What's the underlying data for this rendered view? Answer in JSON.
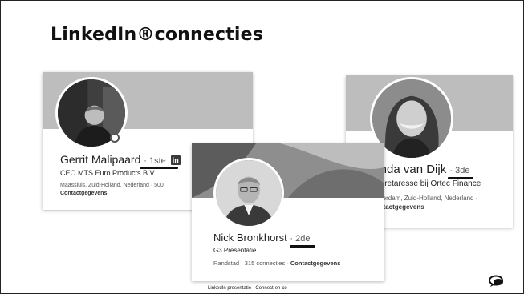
{
  "slide": {
    "title": "LinkedIn®connecties"
  },
  "cards": [
    {
      "name": "Gerrit Malipaard",
      "degree": "1ste",
      "headline": "CEO MTS Euro Products B.V.",
      "location": "Maassluis, Zuid-Holland, Nederland · 500",
      "contact": "Contactgegevens"
    },
    {
      "name": "Nick Bronkhorst",
      "degree": "2de",
      "headline": "G3 Presentatie",
      "location": "Randstad · 315 connecties · ",
      "contact": "Contactgegevens"
    },
    {
      "name": "Linda van Dijk",
      "degree": "3de",
      "headline": "Secretaresse bij Ortec Finance",
      "location": "Rotterdam, Zuid-Holland, Nederland ·",
      "contact": "Contactgegevens"
    }
  ],
  "footer": {
    "text": "LinkedIn presentatie - Connect-en-co"
  },
  "icons": {
    "linkedin_badge": "in",
    "chat": "chat-bubbles-icon"
  }
}
